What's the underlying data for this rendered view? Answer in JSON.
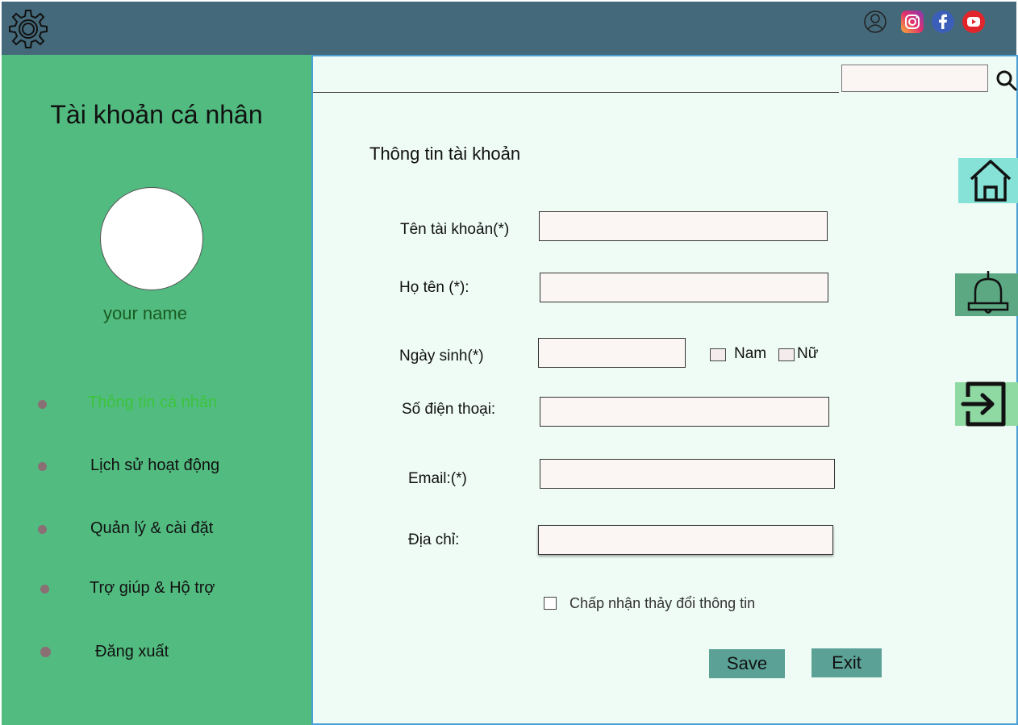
{
  "header": {
    "icons": [
      "settings-gear-icon",
      "user-profile-icon",
      "instagram-icon",
      "facebook-icon",
      "youtube-icon"
    ]
  },
  "sidebar": {
    "title": "Tài khoản cá nhân",
    "username": "your name",
    "items": [
      {
        "label": "Thông tin cá nhân",
        "active": true
      },
      {
        "label": "Lịch sử hoạt động",
        "active": false
      },
      {
        "label": "Quản lý & cài đặt",
        "active": false
      },
      {
        "label": "Trợ giúp & Hộ trợ",
        "active": false
      },
      {
        "label": "Đăng xuất",
        "active": false
      }
    ]
  },
  "search": {
    "value": "",
    "placeholder": ""
  },
  "form": {
    "title": "Thông tin tài khoản",
    "fields": {
      "username": {
        "label": "Tên tài khoản(*)",
        "value": ""
      },
      "fullname": {
        "label": "Họ tên (*):",
        "value": ""
      },
      "birthday": {
        "label": "Ngày sinh(*)",
        "value": ""
      },
      "phone": {
        "label": "Số điện thoại:",
        "value": ""
      },
      "email": {
        "label": "Email:(*)",
        "value": ""
      },
      "address": {
        "label": "Địa chỉ:",
        "value": ""
      }
    },
    "gender": {
      "male": "Nam",
      "female": "Nữ"
    },
    "accept_label": "Chấp nhận thảy đổi thông tin",
    "save_label": "Save",
    "exit_label": "Exit"
  },
  "right_nav": {
    "icons": [
      "home-icon",
      "bell-icon",
      "logout-icon"
    ]
  },
  "colors": {
    "topbar": "#44697a",
    "sidebar": "#52bb80",
    "main_bg": "#effcf6",
    "active_nav": "#3cc43c",
    "button": "#5ba196"
  }
}
